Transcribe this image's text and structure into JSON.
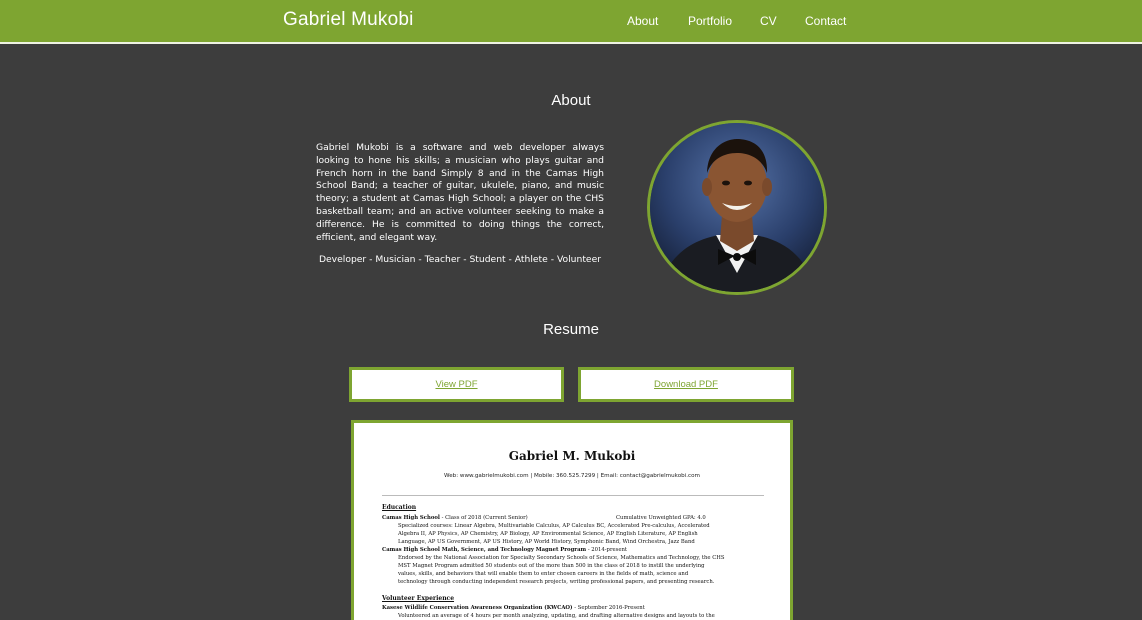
{
  "brand": "Gabriel Mukobi",
  "nav": {
    "items": [
      {
        "label": "About"
      },
      {
        "label": "Portfolio"
      },
      {
        "label": "CV"
      },
      {
        "label": "Contact"
      }
    ]
  },
  "about": {
    "title": "About",
    "text": "Gabriel Mukobi is a software and web developer always looking to hone his skills; a musician who plays guitar and French horn in the band Simply 8 and in the Camas High School Band; a teacher of guitar, ukulele, piano, and music theory; a student at Camas High School; a player on the CHS basketball team; and an active volunteer seeking to make a difference. He is committed to doing things the correct, efficient, and elegant way.",
    "roles": "Developer - Musician - Teacher - Student - Athlete - Volunteer"
  },
  "resume": {
    "title": "Resume",
    "view_label": "View PDF",
    "download_label": "Download PDF",
    "preview": {
      "name": "Gabriel M. Mukobi",
      "contact": "Web: www.gabrielmukobi.com | Mobile: 360.525.7299 | Email: contact@gabrielmukobi.com",
      "education_heading": "Education",
      "school": "Camas High School",
      "school_class": "- Class of 2018 (Current Senior)",
      "gpa": "Cumulative Unweighted GPA: 4.0",
      "courses_1": "Specialized courses: Linear Algebra, Multivariable Calculus, AP Calculus BC, Accelerated Pre-calculus, Accelerated",
      "courses_2": "Algebra II, AP Physics, AP Chemistry, AP Biology, AP Environmental Science, AP English Literature, AP English",
      "courses_3": "Language, AP US Government, AP US History, AP World History, Symphonic Band, Wind Orchestra, Jazz Band",
      "magnet": "Camas High School Math, Science, and Technology Magnet Program",
      "magnet_dates": "- 2014-present",
      "magnet_1": "Endorsed by the National Association for Specialty Secondary Schools of Science, Mathematics and Technology, the CHS",
      "magnet_2": "MST Magnet Program admitted 50 students out of the more than 500 in the class of 2018 to instill the underlying",
      "magnet_3": "values, skills, and behaviors that will enable them to enter chosen careers in the fields of math, science and",
      "magnet_4": "technology through conducting independent research projects, writing professional papers, and presenting research.",
      "volunteer_heading": "Volunteer Experience",
      "org": "Kasese Wildlife Conservation Awareness Organization (KWCAO)",
      "org_dates": "- September 2016-Present",
      "org_1": "Volunteered an average of 4 hours per month analyzing, updating, and drafting alternative designs and layouts to the"
    }
  },
  "colors": {
    "accent": "#7ea531",
    "background": "#3d3d3d",
    "text": "#ffffff"
  }
}
